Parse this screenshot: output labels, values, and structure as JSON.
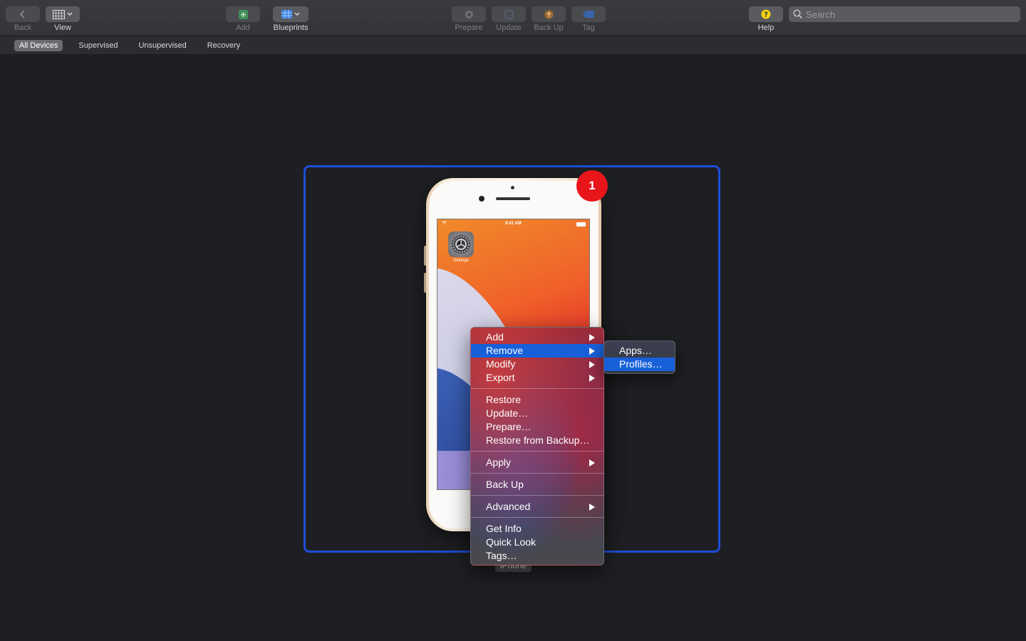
{
  "toolbar": {
    "back_label": "Back",
    "view_label": "View",
    "add_label": "Add",
    "blueprints_label": "Blueprints",
    "prepare_label": "Prepare",
    "update_label": "Update",
    "backup_label": "Back Up",
    "tag_label": "Tag",
    "help_label": "Help",
    "search_placeholder": "Search"
  },
  "scopes": [
    "All Devices",
    "Supervised",
    "Unsupervised",
    "Recovery"
  ],
  "device": {
    "name": "iPhone",
    "badge": "1",
    "status_time": "9:41 AM",
    "app_label": "Settings"
  },
  "menu": {
    "add": "Add",
    "remove": "Remove",
    "modify": "Modify",
    "export": "Export",
    "restore": "Restore",
    "update": "Update…",
    "prepare": "Prepare…",
    "restore_backup": "Restore from Backup…",
    "apply": "Apply",
    "backup": "Back Up",
    "advanced": "Advanced",
    "get_info": "Get Info",
    "quick_look": "Quick Look",
    "tags": "Tags…"
  },
  "submenu": {
    "apps": "Apps…",
    "profiles": "Profiles…"
  },
  "colors": {
    "accent": "#1760d9",
    "selection": "#1d4ed8",
    "badge": "#e8151b"
  }
}
